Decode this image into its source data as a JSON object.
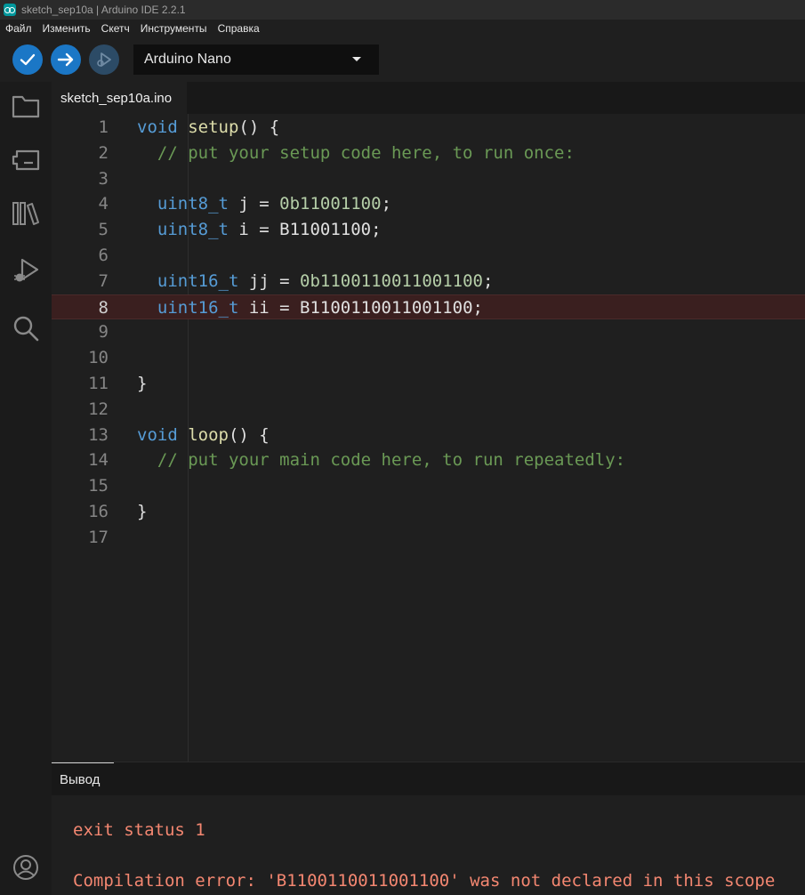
{
  "window": {
    "title": "sketch_sep10a | Arduino IDE 2.2.1"
  },
  "menu": [
    "Файл",
    "Изменить",
    "Скетч",
    "Инструменты",
    "Справка"
  ],
  "toolbar": {
    "board": "Arduino Nano"
  },
  "tab": {
    "filename": "sketch_sep10a.ino"
  },
  "editor": {
    "lines": [
      {
        "n": "1",
        "parts": [
          [
            "kw",
            "void"
          ],
          [
            "tx",
            " "
          ],
          [
            "fn",
            "setup"
          ],
          [
            "tx",
            "() {"
          ]
        ]
      },
      {
        "n": "2",
        "parts": [
          [
            "tx",
            "  "
          ],
          [
            "cm",
            "// put your setup code here, to run once:"
          ]
        ]
      },
      {
        "n": "3",
        "parts": []
      },
      {
        "n": "4",
        "parts": [
          [
            "tx",
            "  "
          ],
          [
            "kw",
            "uint8_t"
          ],
          [
            "tx",
            " j = "
          ],
          [
            "num",
            "0b11001100"
          ],
          [
            "tx",
            ";"
          ]
        ]
      },
      {
        "n": "5",
        "parts": [
          [
            "tx",
            "  "
          ],
          [
            "kw",
            "uint8_t"
          ],
          [
            "tx",
            " i = B11001100;"
          ]
        ]
      },
      {
        "n": "6",
        "parts": []
      },
      {
        "n": "7",
        "parts": [
          [
            "tx",
            "  "
          ],
          [
            "kw",
            "uint16_t"
          ],
          [
            "tx",
            " jj = "
          ],
          [
            "num",
            "0b1100110011001100"
          ],
          [
            "tx",
            ";"
          ]
        ]
      },
      {
        "n": "8",
        "parts": [
          [
            "tx",
            "  "
          ],
          [
            "kw",
            "uint16_t"
          ],
          [
            "tx",
            " ii = B1100110011001100;"
          ]
        ]
      },
      {
        "n": "9",
        "parts": []
      },
      {
        "n": "10",
        "parts": []
      },
      {
        "n": "11",
        "parts": [
          [
            "tx",
            "}"
          ]
        ]
      },
      {
        "n": "12",
        "parts": []
      },
      {
        "n": "13",
        "parts": [
          [
            "kw",
            "void"
          ],
          [
            "tx",
            " "
          ],
          [
            "fn",
            "loop"
          ],
          [
            "tx",
            "() {"
          ]
        ]
      },
      {
        "n": "14",
        "parts": [
          [
            "tx",
            "  "
          ],
          [
            "cm",
            "// put your main code here, to run repeatedly:"
          ]
        ]
      },
      {
        "n": "15",
        "parts": []
      },
      {
        "n": "16",
        "parts": [
          [
            "tx",
            "}"
          ]
        ]
      },
      {
        "n": "17",
        "parts": []
      }
    ],
    "error_line": "8"
  },
  "output": {
    "title": "Вывод",
    "lines": [
      "exit status 1",
      "",
      "Compilation error: 'B1100110011001100' was not declared in this scope"
    ]
  },
  "icons": {
    "verify": "check-icon",
    "upload": "arrow-right-icon",
    "debug": "debug-icon",
    "sidebar": [
      "folder-icon",
      "board-icon",
      "library-icon",
      "debug-run-icon",
      "search-icon",
      "account-icon"
    ]
  },
  "colors": {
    "accent": "#1b77c6",
    "error_text": "#f48771",
    "keyword": "#569cd6",
    "comment": "#6a9955"
  }
}
